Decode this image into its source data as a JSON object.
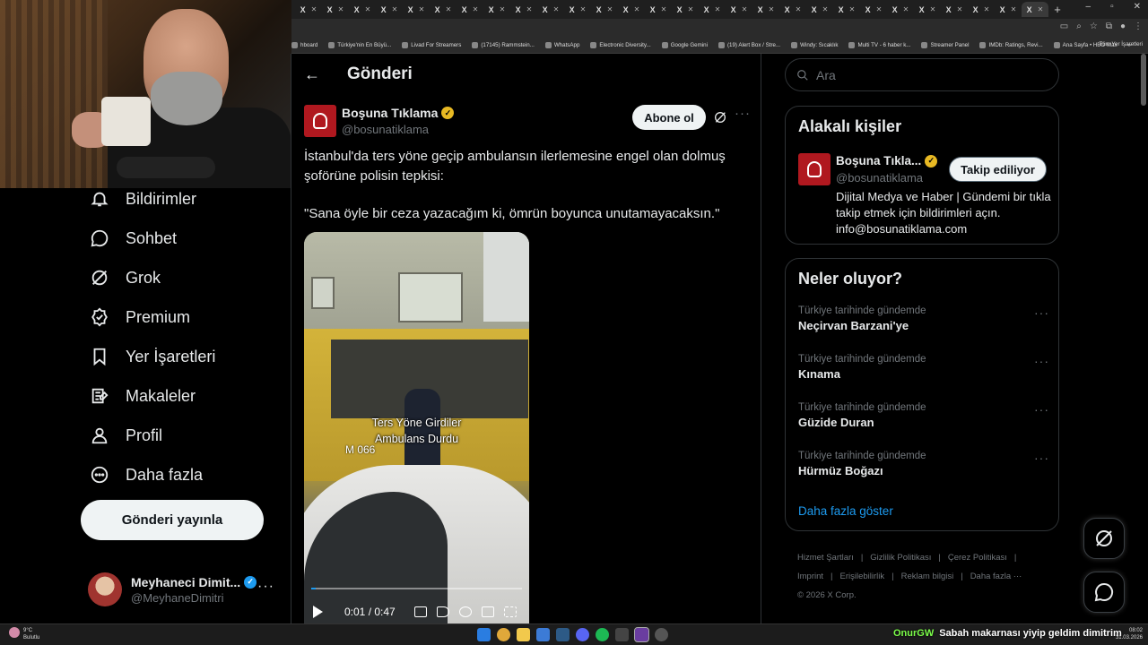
{
  "browser": {
    "tab_glyph": "X",
    "tab_close": "✕",
    "tab_count": 28,
    "new_tab": "+",
    "window_controls": [
      "–",
      "▫",
      "✕"
    ],
    "bookmarks": [
      "hboard",
      "Türkiye'nin En Büyü...",
      "Livad For Streamers",
      "(17145) Rammstein...",
      "WhatsApp",
      "Electronic Diversity...",
      "Google Gemini",
      "(19) Alert Box / Stre...",
      "Windy: Sıcaklık",
      "Multi TV - 6 haber k...",
      "Streamer Panel",
      "IMDb: Ratings, Revi...",
      "Ana Sayfa • HBO Max"
    ],
    "bookmarks_more": "»",
    "all_bookmarks": "Tüm Yer İşaretleri"
  },
  "nav": {
    "items": [
      {
        "label": "Bildirimler",
        "icon": "bell-icon"
      },
      {
        "label": "Sohbet",
        "icon": "chat-icon"
      },
      {
        "label": "Grok",
        "icon": "grok-icon"
      },
      {
        "label": "Premium",
        "icon": "premium-icon"
      },
      {
        "label": "Yer İşaretleri",
        "icon": "bookmark-icon"
      },
      {
        "label": "Makaleler",
        "icon": "article-icon"
      },
      {
        "label": "Profil",
        "icon": "profile-icon"
      },
      {
        "label": "Daha fazla",
        "icon": "more-circle-icon"
      }
    ],
    "post_button": "Gönderi yayınla",
    "account": {
      "name": "Meyhaneci Dimit...",
      "handle": "@MeyhaneDimitri",
      "more": "···"
    }
  },
  "post": {
    "header_title": "Gönderi",
    "back_glyph": "←",
    "author_name": "Boşuna Tıklama",
    "author_handle": "@bosunatiklama",
    "subscribe_label": "Abone ol",
    "more": "···",
    "text_line1": "İstanbul'da ters yöne geçip ambulansın ilerlemesine engel olan dolmuş şoförüne polisin tepkisi:",
    "text_line2": "\"Sana öyle bir ceza yazacağım ki, ömrün boyunca unutamayacaksın.\"",
    "video": {
      "caption_line1": "Ters Yöne Girdiler",
      "caption_line2": "Ambulans Durdu",
      "plate": "M 066",
      "time": "0:01 / 0:47",
      "progress": 0.02
    }
  },
  "sidebar": {
    "search_placeholder": "Ara",
    "related_title": "Alakalı kişiler",
    "related": {
      "name": "Boşuna Tıkla...",
      "handle": "@bosunatiklama",
      "follow_label": "Takip ediliyor",
      "bio": "Dijital Medya ve Haber | Gündemi bir tıkla takip etmek için bildirimleri açın. info@bosunatiklama.com"
    },
    "trends_title": "Neler oluyor?",
    "trends": [
      {
        "meta": "Türkiye tarihinde gündemde",
        "name": "Neçirvan Barzani'ye"
      },
      {
        "meta": "Türkiye tarihinde gündemde",
        "name": "Kınama"
      },
      {
        "meta": "Türkiye tarihinde gündemde",
        "name": "Güzide Duran"
      },
      {
        "meta": "Türkiye tarihinde gündemde",
        "name": "Hürmüz Boğazı"
      }
    ],
    "trend_more": "···",
    "show_more": "Daha fazla göster",
    "footer": [
      "Hizmet Şartları",
      "Gizlilik Politikası",
      "Çerez Politikası",
      "Imprint",
      "Erişilebilirlik",
      "Reklam bilgisi",
      "Daha fazla ···"
    ],
    "footer_separator": "|",
    "copyright": "© 2026 X Corp."
  },
  "taskbar": {
    "weather_temp": "9°C",
    "weather_desc": "Bulutlu",
    "chat_user": "OnurGW",
    "chat_message": "Sabah makarnası yiyip geldim dimitrim",
    "time": "08:02",
    "date": "31.03.2026"
  },
  "colors": {
    "accent": "#1d9bf0",
    "brand_red": "#b0181f",
    "verified_gold": "#e8b923",
    "chat_green": "#7cff4a"
  }
}
